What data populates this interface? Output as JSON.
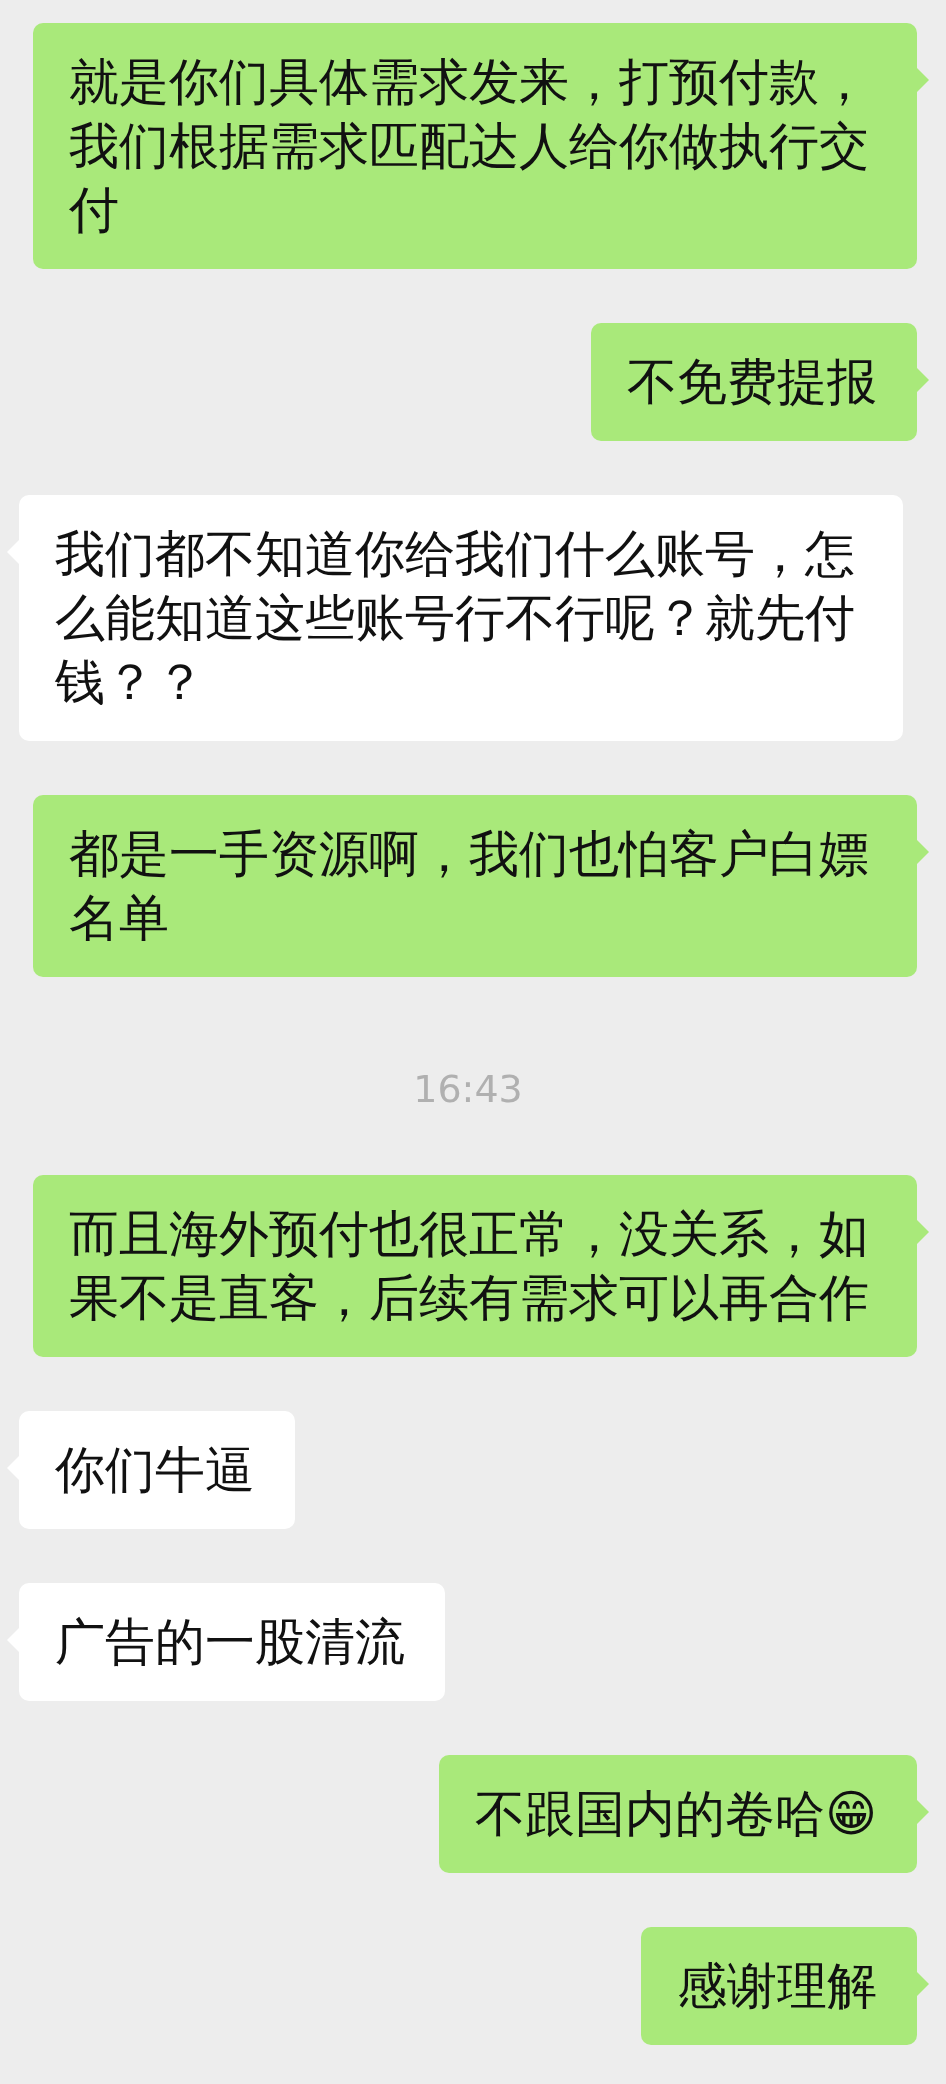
{
  "messages": [
    {
      "kind": "sent",
      "text": "就是你们具体需求发来，打预付款，我们根据需求匹配达人给你做执行交付"
    },
    {
      "kind": "sent",
      "text": "不免费提报"
    },
    {
      "kind": "received",
      "text": "我们都不知道你给我们什么账号，怎么能知道这些账号行不行呢？就先付钱？？"
    },
    {
      "kind": "sent",
      "text": "都是一手资源啊，我们也怕客户白嫖名单"
    },
    {
      "kind": "time",
      "text": "16:43"
    },
    {
      "kind": "sent",
      "text": "而且海外预付也很正常，没关系，如果不是直客，后续有需求可以再合作"
    },
    {
      "kind": "received",
      "text": "你们牛逼"
    },
    {
      "kind": "received",
      "text": "广告的一股清流"
    },
    {
      "kind": "sent",
      "text": "不跟国内的卷哈😁"
    },
    {
      "kind": "sent",
      "text": "感谢理解"
    }
  ]
}
